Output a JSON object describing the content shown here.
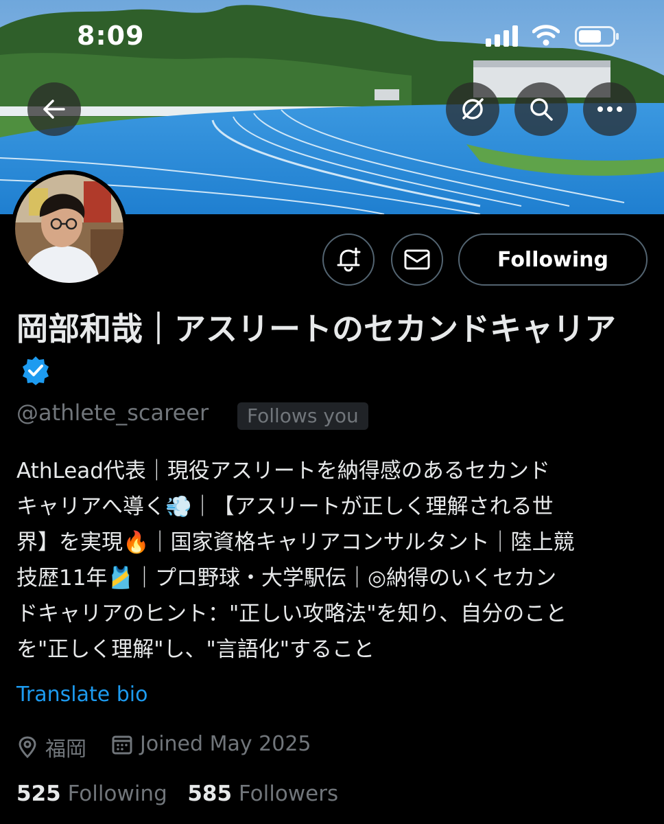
{
  "status_bar": {
    "time": "8:09"
  },
  "header": {
    "back_icon": "arrow-left-icon",
    "grok_icon": "grok-icon",
    "search_icon": "search-icon",
    "more_icon": "more-icon"
  },
  "profile": {
    "name": "岡部和哉｜アスリートのセカンドキャリア",
    "handle": "@athlete_scareer",
    "follows_you": "Follows you",
    "verified": true,
    "bio": "AthLead代表｜現役アスリートを納得感のあるセカンド\nキャリアへ導く💨｜【アスリートが正しく理解される世\n界】を実現🔥｜国家資格キャリアコンサルタント｜陸上競\n技歴11年🎽｜プロ野球・大学駅伝｜◎納得のいくセカン\nドキャリアのヒント：\"正しい攻略法\"を知り、自分のこと\nを\"正しく理解\"し、\"言語化\"すること",
    "translate_label": "Translate bio",
    "location": "福岡",
    "joined": "Joined May 2025",
    "following_count": "525",
    "following_label": "Following",
    "followers_count": "585",
    "followers_label": "Followers"
  },
  "actions": {
    "notify_icon": "bell-plus-icon",
    "message_icon": "envelope-icon",
    "following_button": "Following"
  },
  "colors": {
    "background": "#000000",
    "accent": "#1d9bf0",
    "muted": "#71767b",
    "text": "#e7e9ea"
  }
}
